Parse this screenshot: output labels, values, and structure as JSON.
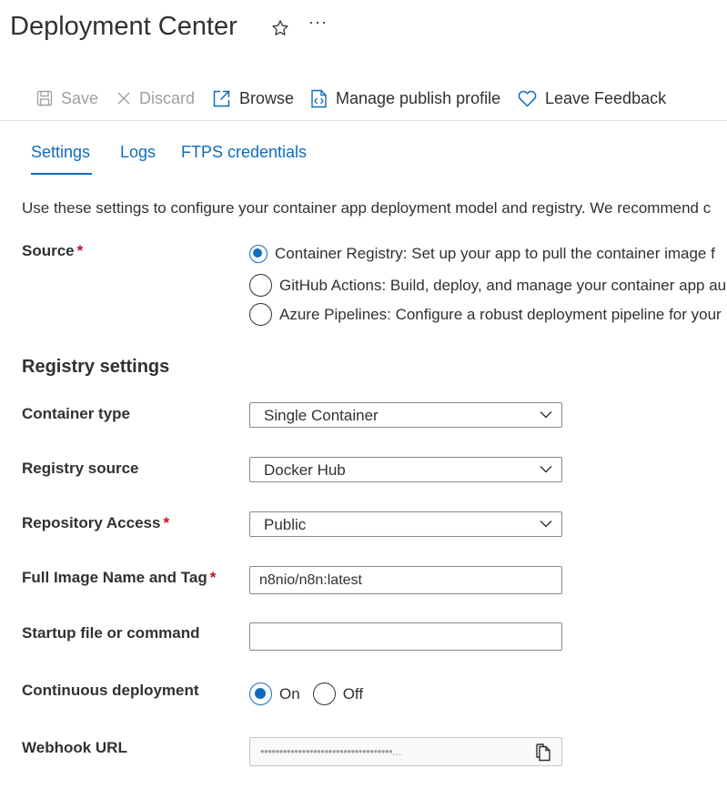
{
  "header": {
    "title": "Deployment Center",
    "more": "···"
  },
  "toolbar": {
    "save": "Save",
    "discard": "Discard",
    "browse": "Browse",
    "manage_publish_profile": "Manage publish profile",
    "leave_feedback": "Leave Feedback"
  },
  "tabs": [
    {
      "label": "Settings",
      "active": true
    },
    {
      "label": "Logs",
      "active": false
    },
    {
      "label": "FTPS credentials",
      "active": false
    }
  ],
  "description": "Use these settings to configure your container app deployment model and registry. We recommend c",
  "source": {
    "label": "Source",
    "required": "*",
    "options": [
      {
        "label": "Container Registry: Set up your app to pull the container image f",
        "selected": true
      },
      {
        "label": "GitHub Actions: Build, deploy, and manage your container app au",
        "selected": false
      },
      {
        "label": "Azure Pipelines: Configure a robust deployment pipeline for your",
        "selected": false
      }
    ]
  },
  "registry": {
    "section_title": "Registry settings",
    "container_type": {
      "label": "Container type",
      "value": "Single Container"
    },
    "registry_source": {
      "label": "Registry source",
      "value": "Docker Hub"
    },
    "repository_access": {
      "label": "Repository Access",
      "required": "*",
      "value": "Public"
    },
    "image": {
      "label": "Full Image Name and Tag",
      "required": "*",
      "value": "n8nio/n8n:latest"
    },
    "startup": {
      "label": "Startup file or command",
      "value": ""
    },
    "continuous_deployment": {
      "label": "Continuous deployment",
      "on": "On",
      "off": "Off",
      "selected": "On"
    },
    "webhook": {
      "label": "Webhook URL",
      "masked": "•••••••••••••••••••••••••••••••••••..."
    }
  },
  "colors": {
    "accent": "#0f6cbd",
    "required": "#c50f1f",
    "disabled": "#a19f9d"
  }
}
